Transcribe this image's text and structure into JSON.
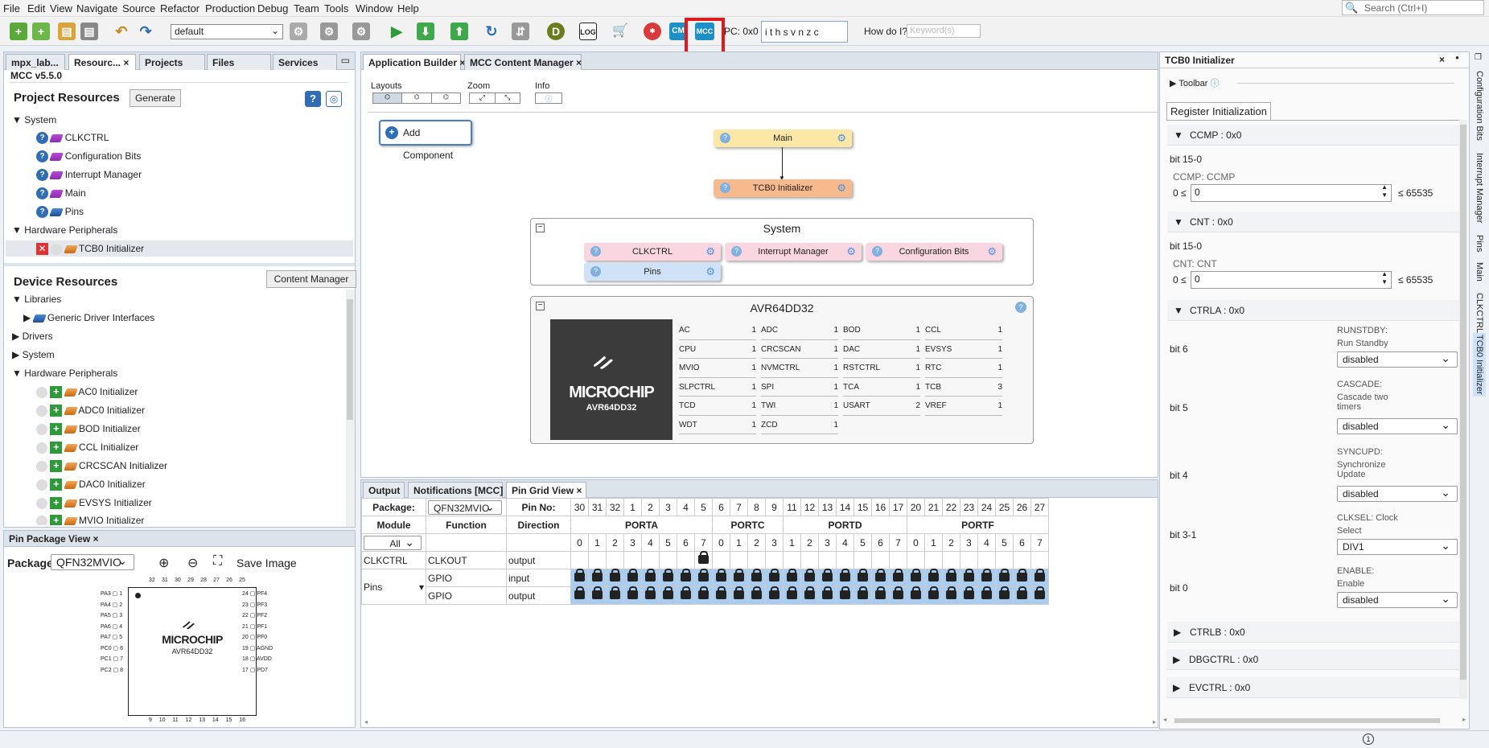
{
  "menu": [
    "File",
    "Edit",
    "View",
    "Navigate",
    "Source",
    "Refactor",
    "Production",
    "Debug",
    "Team",
    "Tools",
    "Window",
    "Help"
  ],
  "search": {
    "placeholder": "Search (Ctrl+I)"
  },
  "toolbar": {
    "config": "default",
    "pc": "PC: 0x0",
    "flags": "i t h s v n z c",
    "howdoi": "How do I?",
    "keyword_placeholder": "Keyword(s)",
    "icons": [
      "new-file-icon",
      "new-project-icon",
      "open-project-icon",
      "close-project-icon",
      "undo-icon",
      "redo-icon",
      "build-icon",
      "clean-build-icon",
      "make-icon",
      "run-icon",
      "debug-icon",
      "program-icon",
      "read-icon",
      "reset-icon",
      "dv-icon",
      "log-icon",
      "cart-icon",
      "mcc-icon"
    ]
  },
  "left_tabs": [
    "mpx_lab...",
    "Resourc...",
    "Projects",
    "Files",
    "Services"
  ],
  "mcc_version": "MCC v5.5.0",
  "project_resources": {
    "title": "Project Resources",
    "generate": "Generate",
    "system": "System",
    "items": [
      "CLKCTRL",
      "Configuration Bits",
      "Interrupt Manager",
      "Main",
      "Pins"
    ],
    "hw": "Hardware Peripherals",
    "hw_items": [
      "TCB0 Initializer"
    ]
  },
  "device_resources": {
    "title": "Device Resources",
    "content_manager": "Content Manager",
    "libraries": "Libraries",
    "generic": "Generic Driver Interfaces",
    "drivers": "Drivers",
    "system": "System",
    "hw": "Hardware Peripherals",
    "hw_items": [
      "AC0 Initializer",
      "ADC0 Initializer",
      "BOD Initializer",
      "CCL Initializer",
      "CRCSCAN Initializer",
      "DAC0 Initializer",
      "EVSYS Initializer",
      "MVIO Initializer"
    ]
  },
  "pin_package": {
    "title": "Pin Package View",
    "package_label": "Package:",
    "package": "QFN32MVIO",
    "save": "Save Image",
    "chip": "AVR64DD32",
    "logo": "MICROCHIP",
    "left_pins": [
      [
        "PA3",
        "1"
      ],
      [
        "PA4",
        "2"
      ],
      [
        "PA5",
        "3"
      ],
      [
        "PA6",
        "4"
      ],
      [
        "PA7",
        "5"
      ],
      [
        "PC0",
        "6"
      ],
      [
        "PC1",
        "7"
      ],
      [
        "PC2",
        "8"
      ]
    ],
    "right_pins": [
      [
        "24",
        "PF4"
      ],
      [
        "23",
        "PF3"
      ],
      [
        "22",
        "PF2"
      ],
      [
        "21",
        "PF1"
      ],
      [
        "20",
        "PF0"
      ],
      [
        "19",
        "AGND"
      ],
      [
        "18",
        "AVDD"
      ],
      [
        "17",
        "PD7"
      ]
    ],
    "top_nums": [
      "32",
      "31",
      "30",
      "29",
      "28",
      "27",
      "26",
      "25"
    ],
    "bottom_nums": [
      "9",
      "10",
      "11",
      "12",
      "13",
      "14",
      "15",
      "16"
    ]
  },
  "center_tabs": [
    "Application Builder",
    "MCC Content Manager"
  ],
  "builder": {
    "layouts": "Layouts",
    "zoom": "Zoom",
    "info": "Info",
    "add": "Add Component",
    "main": "Main",
    "tcb0": "TCB0 Initializer",
    "system_title": "System",
    "sys_nodes": [
      "CLKCTRL",
      "Interrupt Manager",
      "Configuration Bits",
      "Pins"
    ],
    "device_title": "AVR64DD32",
    "chip_logo": "MICROCHIP",
    "chip_name": "AVR64DD32",
    "periph": [
      [
        "AC",
        "1"
      ],
      [
        "ADC",
        "1"
      ],
      [
        "BOD",
        "1"
      ],
      [
        "CCL",
        "1"
      ],
      [
        "CPU",
        "1"
      ],
      [
        "CRCSCAN",
        "1"
      ],
      [
        "DAC",
        "1"
      ],
      [
        "EVSYS",
        "1"
      ],
      [
        "MVIO",
        "1"
      ],
      [
        "NVMCTRL",
        "1"
      ],
      [
        "RSTCTRL",
        "1"
      ],
      [
        "RTC",
        "1"
      ],
      [
        "SLPCTRL",
        "1"
      ],
      [
        "SPI",
        "1"
      ],
      [
        "TCA",
        "1"
      ],
      [
        "TCB",
        "3"
      ],
      [
        "TCD",
        "1"
      ],
      [
        "TWI",
        "1"
      ],
      [
        "USART",
        "2"
      ],
      [
        "VREF",
        "1"
      ],
      [
        "WDT",
        "1"
      ],
      [
        "ZCD",
        "1"
      ]
    ]
  },
  "bottom_tabs": [
    "Output",
    "Notifications [MCC]",
    "Pin Grid View"
  ],
  "pingrid": {
    "package_label": "Package:",
    "package": "QFN32MVIO",
    "pin_no": "Pin No:",
    "pins": [
      "30",
      "31",
      "32",
      "1",
      "2",
      "3",
      "4",
      "5",
      "6",
      "7",
      "8",
      "9",
      "11",
      "12",
      "13",
      "14",
      "15",
      "16",
      "17",
      "20",
      "21",
      "22",
      "23",
      "24",
      "25",
      "26",
      "27"
    ],
    "module": "Module",
    "function": "Function",
    "direction": "Direction",
    "filter": "All",
    "ports": [
      {
        "name": "PORTA",
        "bits": [
          "0",
          "1",
          "2",
          "3",
          "4",
          "5",
          "6",
          "7"
        ]
      },
      {
        "name": "PORTC",
        "bits": [
          "0",
          "1",
          "2",
          "3"
        ]
      },
      {
        "name": "PORTD",
        "bits": [
          "1",
          "2",
          "3",
          "4",
          "5",
          "6",
          "7"
        ]
      },
      {
        "name": "PORTF",
        "bits": [
          "0",
          "1",
          "2",
          "3",
          "4",
          "5",
          "6",
          "7"
        ]
      }
    ],
    "rows": [
      {
        "module": "CLKCTRL",
        "function": "CLKOUT",
        "direction": "output"
      },
      {
        "module": "Pins",
        "function": "GPIO",
        "direction": "input"
      },
      {
        "module": "",
        "function": "GPIO",
        "direction": "output"
      }
    ]
  },
  "right": {
    "title": "TCB0 Initializer",
    "toolbar": "Toolbar",
    "tab": "Register Initialization",
    "ccmp": {
      "header": "CCMP : 0x0",
      "bits": "bit 15-0",
      "label": "CCMP: CCMP",
      "min": "0 ≤",
      "value": "0",
      "max": "≤ 65535"
    },
    "cnt": {
      "header": "CNT : 0x0",
      "bits": "bit 15-0",
      "label": "CNT: CNT",
      "min": "0 ≤",
      "value": "0",
      "max": "≤ 65535"
    },
    "ctrla": {
      "header": "CTRLA : 0x0",
      "fields": [
        {
          "bit": "bit 6",
          "name": "RUNSTDBY:",
          "desc": "Run Standby",
          "value": "disabled"
        },
        {
          "bit": "bit 5",
          "name": "CASCADE:",
          "desc": "Cascade two timers",
          "value": "disabled"
        },
        {
          "bit": "bit 4",
          "name": "SYNCUPD:",
          "desc": "Synchronize Update",
          "value": "disabled"
        },
        {
          "bit": "bit 3-1",
          "name": "CLKSEL: Clock",
          "desc": "Select",
          "value": "DIV1"
        },
        {
          "bit": "bit 0",
          "name": "ENABLE:",
          "desc": "Enable",
          "value": "disabled"
        }
      ]
    },
    "collapsed": [
      "CTRLB : 0x0",
      "DBGCTRL : 0x0",
      "EVCTRL : 0x0"
    ]
  },
  "side_tabs": [
    "Configuration Bits",
    "Interrupt Manager",
    "Pins",
    "Main",
    "CLKCTRL",
    "TCB0 Initializer"
  ]
}
